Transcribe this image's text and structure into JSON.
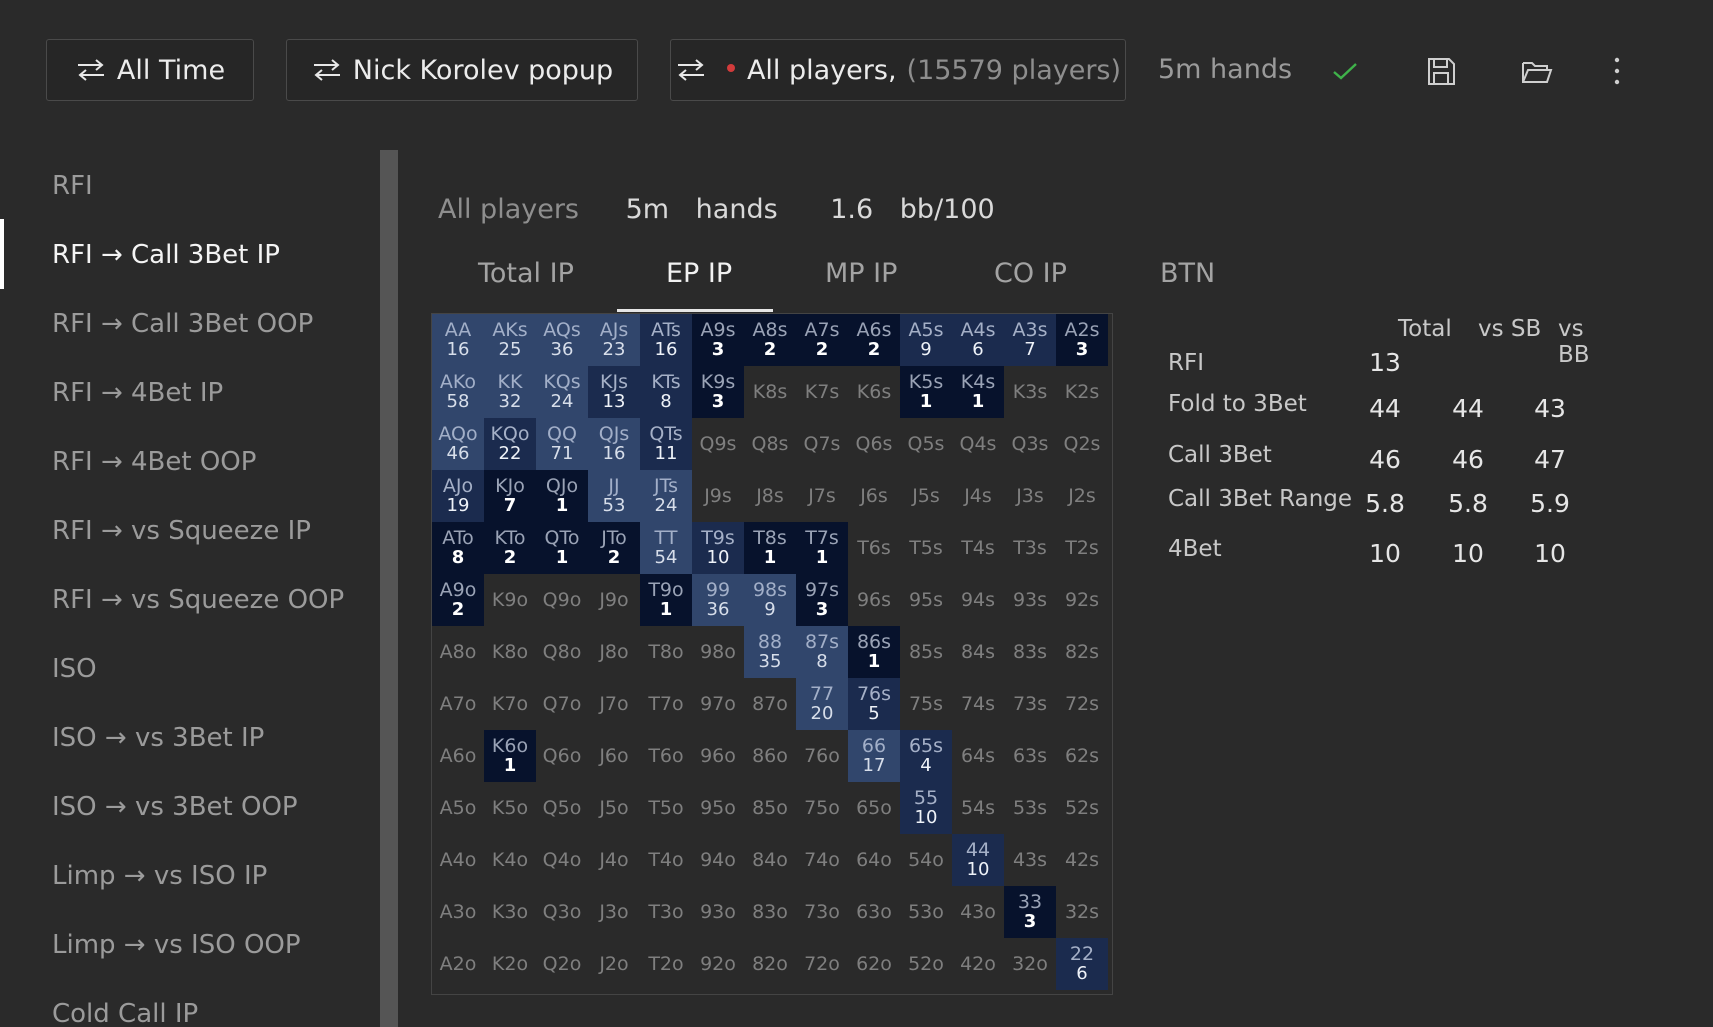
{
  "toolbar": {
    "time_button": "All Time",
    "popup_button": "Nick Korolev popup",
    "players_name": "All players,",
    "players_count": "(15579 players)",
    "hands_label": "5m hands",
    "status_color": "#3fb24a",
    "icons": [
      "swap-icon",
      "checkmark-icon",
      "save-icon",
      "folder-open-icon",
      "more-vertical-icon"
    ]
  },
  "sidebar": {
    "items": [
      "RFI",
      "RFI → Call 3Bet IP",
      "RFI → Call 3Bet OOP",
      "RFI → 4Bet IP",
      "RFI → 4Bet OOP",
      "RFI → vs Squeeze IP",
      "RFI → vs Squeeze OOP",
      "ISO",
      "ISO → vs 3Bet IP",
      "ISO → vs 3Bet OOP",
      "Limp → vs ISO IP",
      "Limp → vs ISO OOP",
      "Cold Call IP"
    ],
    "active_index": 1
  },
  "summary": {
    "players": "All players",
    "hands_value": "5m",
    "hands_unit": "hands",
    "winrate_value": "1.6",
    "winrate_unit": "bb/100"
  },
  "tabs": [
    "Total IP",
    "EP IP",
    "MP IP",
    "CO IP",
    "BTN"
  ],
  "active_tab": 1,
  "grid": {
    "ranks": [
      "A",
      "K",
      "Q",
      "J",
      "T",
      "9",
      "8",
      "7",
      "6",
      "5",
      "4",
      "3",
      "2"
    ],
    "values": {
      "AA": "16",
      "AKs": "25",
      "AQs": "36",
      "AJs": "23",
      "ATs": "16",
      "A9s": "3",
      "A8s": "2",
      "A7s": "2",
      "A6s": "2",
      "A5s": "9",
      "A4s": "6",
      "A3s": "7",
      "A2s": "3",
      "AKo": "58",
      "KK": "32",
      "KQs": "24",
      "KJs": "13",
      "KTs": "8",
      "K9s": "3",
      "K5s": "1",
      "K4s": "1",
      "AQo": "46",
      "KQo": "22",
      "QQ": "71",
      "QJs": "16",
      "QTs": "11",
      "AJo": "19",
      "KJo": "7",
      "QJo": "1",
      "JJ": "53",
      "JTs": "24",
      "ATo": "8",
      "KTo": "2",
      "QTo": "1",
      "JTo": "2",
      "TT": "54",
      "T9s": "10",
      "T8s": "1",
      "T7s": "1",
      "A9o": "2",
      "T9o": "1",
      "99": "36",
      "98s": "9",
      "97s": "3",
      "88": "35",
      "87s": "8",
      "86s": "1",
      "77": "20",
      "76s": "5",
      "K6o": "1",
      "66": "17",
      "65s": "4",
      "55": "10",
      "44": "10",
      "33": "3",
      "22": "6"
    },
    "shade": {
      "AA": "light",
      "AKs": "light",
      "AQs": "light",
      "AJs": "light",
      "ATs": "mid",
      "A9s": "dark",
      "A8s": "dark",
      "A7s": "dark",
      "A6s": "dark",
      "A5s": "mid",
      "A4s": "mid",
      "A3s": "mid",
      "A2s": "dark",
      "AKo": "light",
      "KK": "light",
      "KQs": "light",
      "KJs": "mid",
      "KTs": "mid",
      "K9s": "dark",
      "K5s": "dark",
      "K4s": "dark",
      "AQo": "light",
      "KQo": "mid",
      "QQ": "light",
      "QJs": "light",
      "QTs": "mid",
      "AJo": "mid",
      "KJo": "dark",
      "QJo": "dark",
      "JJ": "light",
      "JTs": "light",
      "ATo": "dark",
      "KTo": "dark",
      "QTo": "dark",
      "JTo": "dark",
      "TT": "light",
      "T9s": "mid",
      "T8s": "dark",
      "T7s": "dark",
      "A9o": "dark",
      "T9o": "dark",
      "99": "light",
      "98s": "light",
      "97s": "dark",
      "88": "light",
      "87s": "light",
      "86s": "dark",
      "77": "light",
      "76s": "mid",
      "K6o": "dark",
      "66": "light",
      "65s": "mid",
      "55": "mid",
      "44": "mid",
      "33": "dark",
      "22": "mid"
    },
    "colors": {
      "light": "#31466c",
      "mid": "#1b2b4e",
      "dark": "#07122c"
    }
  },
  "stats": {
    "headers": [
      "Total",
      "vs SB",
      "vs BB"
    ],
    "rows": [
      {
        "label": "RFI",
        "values": [
          "13",
          "",
          ""
        ]
      },
      {
        "label": "Fold to 3Bet",
        "values": [
          "44",
          "44",
          "43"
        ]
      },
      {
        "label": "Call 3Bet",
        "values": [
          "46",
          "46",
          "47"
        ]
      },
      {
        "label": "Call 3Bet Range",
        "values": [
          "5.8",
          "5.8",
          "5.9"
        ]
      },
      {
        "label": "4Bet",
        "values": [
          "10",
          "10",
          "10"
        ]
      }
    ]
  }
}
